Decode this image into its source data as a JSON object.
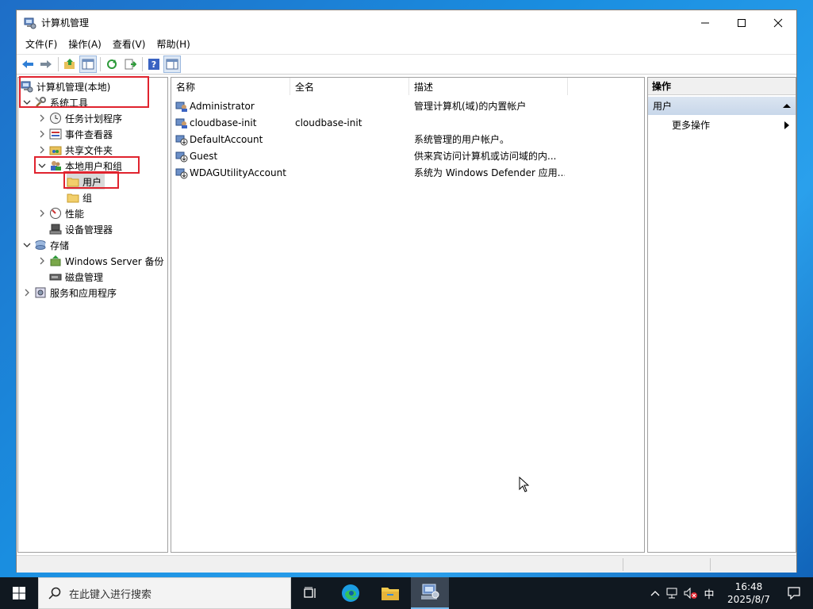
{
  "window": {
    "title": "计算机管理",
    "menu": [
      "文件(F)",
      "操作(A)",
      "查看(V)",
      "帮助(H)"
    ]
  },
  "tree": {
    "root": "计算机管理(本地)",
    "system_tools": "系统工具",
    "task_scheduler": "任务计划程序",
    "event_viewer": "事件查看器",
    "shared_folders": "共享文件夹",
    "local_users_groups": "本地用户和组",
    "users": "用户",
    "groups": "组",
    "performance": "性能",
    "device_manager": "设备管理器",
    "storage": "存储",
    "windows_server_backup": "Windows Server 备份",
    "disk_management": "磁盘管理",
    "services_apps": "服务和应用程序"
  },
  "list": {
    "columns": [
      "名称",
      "全名",
      "描述"
    ],
    "rows": [
      {
        "name": "Administrator",
        "fullname": "",
        "desc": "管理计算机(域)的内置帐户"
      },
      {
        "name": "cloudbase-init",
        "fullname": "cloudbase-init",
        "desc": ""
      },
      {
        "name": "DefaultAccount",
        "fullname": "",
        "desc": "系统管理的用户帐户。"
      },
      {
        "name": "Guest",
        "fullname": "",
        "desc": "供来宾访问计算机或访问域的内..."
      },
      {
        "name": "WDAGUtilityAccount",
        "fullname": "",
        "desc": "系统为 Windows Defender 应用..."
      }
    ]
  },
  "actions": {
    "header": "操作",
    "section": "用户",
    "more": "更多操作"
  },
  "taskbar": {
    "search_placeholder": "在此键入进行搜索",
    "ime": "中",
    "time": "16:48",
    "date": "2025/8/7"
  }
}
